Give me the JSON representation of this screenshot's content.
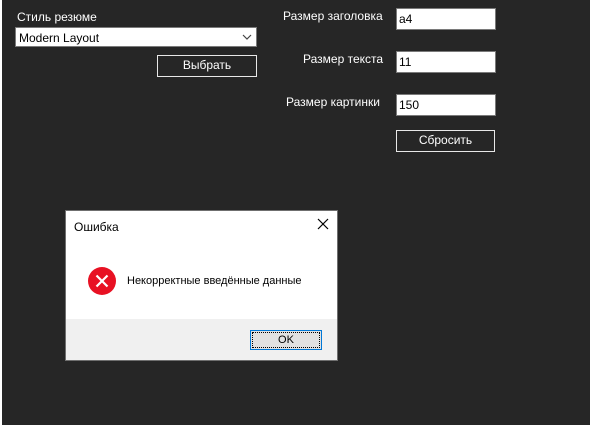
{
  "form": {
    "style_label": "Стиль резюме",
    "style_value": "Modern Layout",
    "choose_button": "Выбрать",
    "header_size_label": "Размер заголовка",
    "header_size_value": "a4",
    "text_size_label": "Размер текста",
    "text_size_value": "11",
    "image_size_label": "Размер картинки",
    "image_size_value": "150",
    "reset_button": "Сбросить"
  },
  "dialog": {
    "title": "Ошибка",
    "message": "Некорректные введённые данные",
    "ok_button": "OK"
  },
  "colors": {
    "background": "#262626",
    "error_icon": "#e81123",
    "focus_border": "#0078d7"
  }
}
